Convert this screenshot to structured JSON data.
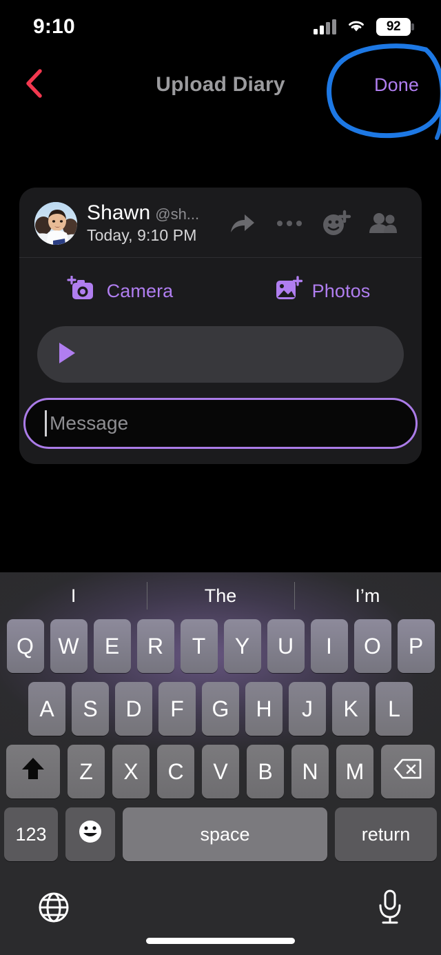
{
  "status_bar": {
    "time": "9:10",
    "battery_percent": "92",
    "signal_icon": "cellular-signal-icon",
    "wifi_icon": "wifi-icon",
    "battery_icon": "battery-icon"
  },
  "nav_bar": {
    "back_icon": "chevron-left-icon",
    "title": "Upload Diary",
    "done_label": "Done",
    "annotation": "hand-drawn-blue-circle"
  },
  "colors": {
    "accent_purple": "#b07ef0",
    "back_red": "#f2384f",
    "annotation_blue": "#1f7ef0",
    "card_bg": "#1b1b1d",
    "page_bg": "#000000"
  },
  "composer_card": {
    "author": {
      "avatar_icon": "user-avatar-photo",
      "name": "Shawn",
      "handle": "@sh...",
      "timestamp": "Today, 9:10 PM"
    },
    "header_actions": [
      {
        "name": "share-icon",
        "label": "Share"
      },
      {
        "name": "more-icon",
        "label": "More"
      },
      {
        "name": "add-reaction-icon",
        "label": "Add reaction"
      },
      {
        "name": "people-icon",
        "label": "People"
      }
    ],
    "sources": [
      {
        "icon": "camera-add-icon",
        "label": "Camera"
      },
      {
        "icon": "photos-add-icon",
        "label": "Photos"
      }
    ],
    "player": {
      "play_icon": "play-icon"
    },
    "message_input": {
      "placeholder": "Message",
      "value": ""
    }
  },
  "keyboard": {
    "predictions": [
      "I",
      "The",
      "I’m"
    ],
    "row1": [
      "Q",
      "W",
      "E",
      "R",
      "T",
      "Y",
      "U",
      "I",
      "O",
      "P"
    ],
    "row2": [
      "A",
      "S",
      "D",
      "F",
      "G",
      "H",
      "J",
      "K",
      "L"
    ],
    "row3": [
      "Z",
      "X",
      "C",
      "V",
      "B",
      "N",
      "M"
    ],
    "shift_icon": "shift-up-arrow-icon",
    "shift_active": true,
    "backspace_icon": "backspace-icon",
    "numbers_label": "123",
    "emoji_icon": "emoji-smiley-icon",
    "space_label": "space",
    "return_label": "return",
    "globe_icon": "globe-icon",
    "mic_icon": "microphone-icon"
  }
}
